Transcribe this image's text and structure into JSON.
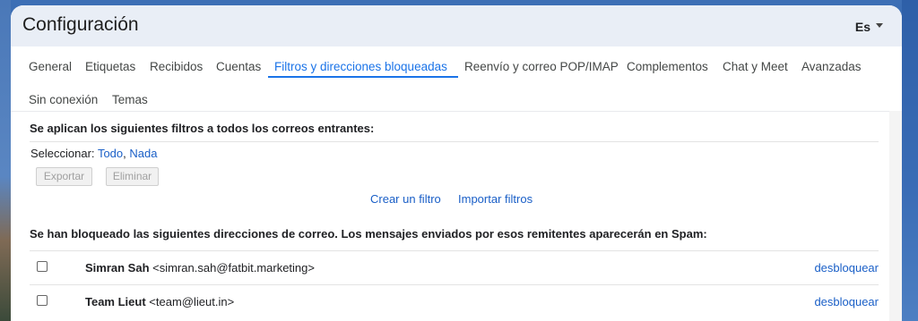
{
  "window": {
    "title": "Configuración",
    "language": "Es"
  },
  "tabs": [
    {
      "label": "General"
    },
    {
      "label": "Etiquetas"
    },
    {
      "label": "Recibidos"
    },
    {
      "label": "Cuentas"
    },
    {
      "label": "Filtros y direcciones bloqueadas",
      "active": true
    },
    {
      "label": "Reenvío y correo POP/IMAP"
    },
    {
      "label": "Complementos"
    },
    {
      "label": "Chat y Meet"
    },
    {
      "label": "Avanzadas"
    },
    {
      "label": "Sin conexión"
    },
    {
      "label": "Temas"
    }
  ],
  "filters": {
    "heading": "Se aplican los siguientes filtros a todos los correos entrantes:",
    "select_label": "Seleccionar:",
    "select_all": "Todo",
    "select_none": "Nada",
    "export_button": "Exportar",
    "delete_button": "Eliminar",
    "create_filter": "Crear un filtro",
    "import_filters": "Importar filtros"
  },
  "blocked": {
    "heading": "Se han bloqueado las siguientes direcciones de correo. Los mensajes enviados por esos remitentes aparecerán en Spam:",
    "unblock_label": "desbloquear",
    "rows": [
      {
        "name": "Simran Sah",
        "email": "<simran.sah@fatbit.marketing>"
      },
      {
        "name": "Team Lieut",
        "email": "<team@lieut.in>"
      }
    ]
  },
  "colors": {
    "accent": "#1a73e8",
    "link": "#1a5fc7",
    "header_bg": "#e9eef6"
  }
}
